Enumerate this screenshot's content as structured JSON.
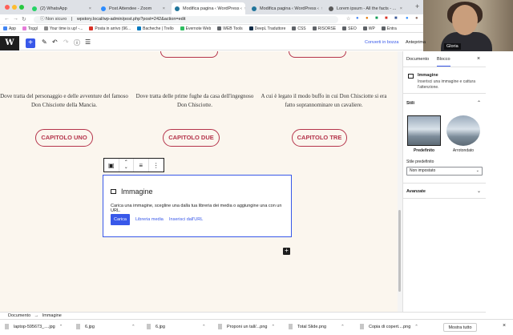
{
  "browser": {
    "tabs": [
      {
        "label": "(2) WhatsApp",
        "active": false,
        "color": "#25d366"
      },
      {
        "label": "Post Attendee - Zoom",
        "active": false,
        "color": "#2d8cff"
      },
      {
        "label": "Modifica pagina ‹ WordPress ‹",
        "active": true,
        "color": "#21759b"
      },
      {
        "label": "Modifica pagina ‹ WordPress ‹",
        "active": false,
        "color": "#21759b"
      },
      {
        "label": "Lorem ipsum - All the facts - ...",
        "active": false,
        "color": "#5a5a5a"
      }
    ],
    "security_label": "Non sicuro",
    "url": "wpstory.local/wp-admin/post.php?post=242&action=edit",
    "bookmarks": [
      {
        "label": "App",
        "color": "#4285f4"
      },
      {
        "label": "Toggl",
        "color": "#e57cd8"
      },
      {
        "label": "Your time is up! -...",
        "color": "#888"
      },
      {
        "label": "Posta in arrivo (96...",
        "color": "#d93025"
      },
      {
        "label": "Bacheche | Trello",
        "color": "#0079bf"
      },
      {
        "label": "Evernote Web",
        "color": "#2dbe60"
      },
      {
        "label": "WEB Tools",
        "color": "#5f6368"
      },
      {
        "label": "DeepL Traduttore",
        "color": "#0f2b46"
      },
      {
        "label": "CSS",
        "color": "#5f6368"
      },
      {
        "label": "RISORSE",
        "color": "#5f6368"
      },
      {
        "label": "SEO",
        "color": "#5f6368"
      },
      {
        "label": "WP",
        "color": "#5f6368"
      },
      {
        "label": "Entra",
        "color": "#5f6368"
      }
    ]
  },
  "zoom": {
    "participant_name": "Gloria"
  },
  "wp_toolbar": {
    "save_draft": "Converti in bozza",
    "preview": "Anteprima"
  },
  "canvas": {
    "columns": [
      {
        "text": "Dove tratta del personaggio e delle avventure del famoso Don Chisciotte della Mancia.",
        "button": "CAPITOLO UNO"
      },
      {
        "text": "Dove tratta delle prime fughe da casa dell'ingegnoso Don Chisciotte.",
        "button": "CAPITOLO DUE"
      },
      {
        "text": "A cui è legato il modo buffo in cui Don Chisciotte si era fatto soprannominare un cavaliere.",
        "button": "CAPITOLO TRE"
      }
    ],
    "image_block": {
      "title": "Immagine",
      "description": "Carica una immagine, scegline una dalla tua libreria dei media o aggiungine una con un URL.",
      "upload": "Carica",
      "media_library": "Libreria media",
      "insert_url": "Inserisci dall'URL"
    }
  },
  "sidebar": {
    "tab_document": "Documento",
    "tab_block": "Blocco",
    "block_title": "Immagine",
    "block_desc": "Inserisci una immagine e cattura l'attenzione.",
    "styles_heading": "Stili",
    "style_default": "Predefinito",
    "style_rounded": "Arrotondato",
    "default_style_label": "Stile predefinito",
    "default_style_value": "Non impostato",
    "advanced": "Avanzate"
  },
  "breadcrumb": {
    "root": "Documento",
    "separator": "→",
    "current": "Immagine"
  },
  "downloads": {
    "items": [
      "laptop-595673_....jpg",
      "6.jpg",
      "6.jpg",
      "Proponi un tall/...png",
      "Total Slide.png",
      "Copia di copert....png"
    ],
    "show_all": "Mostra tutto"
  }
}
